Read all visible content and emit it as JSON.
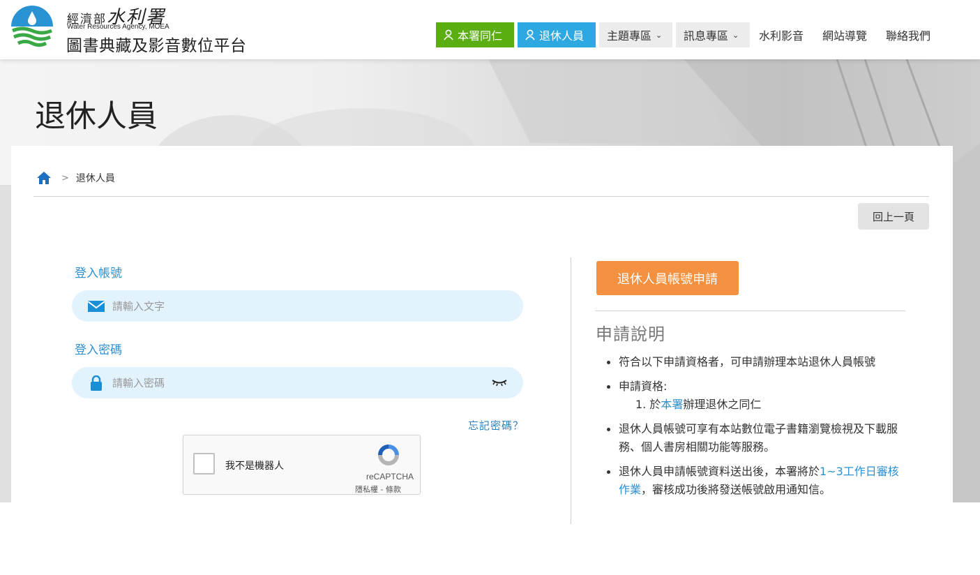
{
  "header": {
    "agency_cn": "經濟部水利署",
    "agency_cn_small": "經濟部",
    "agency_cn_big": "水利署",
    "agency_en": "Water Resources Agency,  MOEA",
    "platform_name": "圖書典藏及影音數位平台"
  },
  "nav": {
    "staff": "本署同仁",
    "retired": "退休人員",
    "topics": "主題專區",
    "news": "訊息專區",
    "video": "水利影音",
    "sitemap": "網站導覽",
    "contact": "聯絡我們"
  },
  "page": {
    "title": "退休人員",
    "breadcrumb_current": "退休人員",
    "breadcrumb_sep": ">",
    "back_button": "回上一頁"
  },
  "login": {
    "account_label": "登入帳號",
    "account_placeholder": "請輸入文字",
    "password_label": "登入密碼",
    "password_placeholder": "請輸入密碼",
    "forgot": "忘記密碼？"
  },
  "captcha": {
    "label": "我不是機器人",
    "brand": "reCAPTCHA",
    "terms": "隱私權 - 條款"
  },
  "apply": {
    "button": "退休人員帳號申請",
    "title": "申請說明",
    "note1": "符合以下申請資格者，可申請辦理本站退休人員帳號",
    "note2_title": "申請資格:",
    "note2_item_prefix": "1. 於",
    "note2_item_link": "本署",
    "note2_item_suffix": "辦理退休之同仁",
    "note3": "退休人員帳號可享有本站數位電子書籍瀏覽檢視及下載服務、個人書房相關功能等服務。",
    "note4_prefix": "退休人員申請帳號資料送出後，本署將於",
    "note4_highlight": "1~3工作日審核作業",
    "note4_suffix": "，審核成功後將發送帳號啟用通知信。"
  },
  "colors": {
    "staff_green": "#5aae12",
    "retired_blue": "#2ea8e0",
    "apply_orange": "#f39140",
    "link_blue": "#2f8fcf",
    "input_bg": "#e3f3fd"
  },
  "icons": [
    "agency-logo-icon",
    "user-icon",
    "chevron-down-icon",
    "home-icon",
    "envelope-icon",
    "lock-icon",
    "eye-closed-icon",
    "recaptcha-icon"
  ]
}
